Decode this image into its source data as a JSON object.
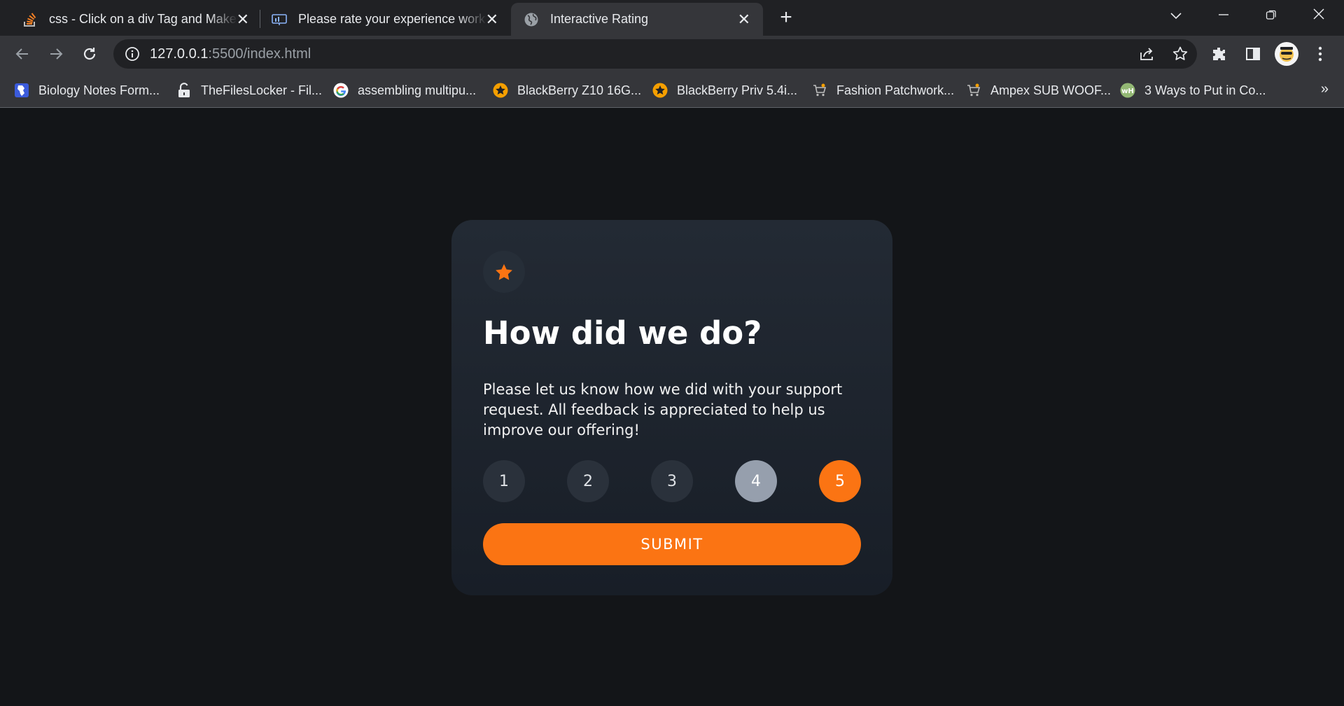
{
  "browser": {
    "tabs": [
      {
        "title": "css - Click on a div Tag and Make",
        "icon": "stackoverflow-icon"
      },
      {
        "title": "Please rate your experience work",
        "icon": "presentation-icon"
      },
      {
        "title": "Interactive Rating",
        "icon": "globe-icon"
      }
    ],
    "new_tab": "+",
    "url_host": "127.0.0.1",
    "url_rest": ":5500/index.html",
    "bookmarks": [
      {
        "label": "Biology Notes Form...",
        "icon": "africa-map-icon"
      },
      {
        "label": "TheFilesLocker - Fil...",
        "icon": "padlock-icon"
      },
      {
        "label": "assembling multipu...",
        "icon": "google-icon"
      },
      {
        "label": "BlackBerry Z10 16G...",
        "icon": "orange-star-icon"
      },
      {
        "label": "BlackBerry Priv 5.4i...",
        "icon": "orange-star-icon"
      },
      {
        "label": "Fashion Patchwork...",
        "icon": "cart-icon"
      },
      {
        "label": "Ampex SUB WOOF...",
        "icon": "cart-icon"
      },
      {
        "label": "3 Ways to Put in Co...",
        "icon": "wikihow-icon"
      }
    ],
    "bookmarks_more": "»"
  },
  "colors": {
    "accent": "#fb7413",
    "hover_gray": "#969fad",
    "page_bg": "#131518",
    "card_top": "#232a34",
    "card_bottom": "#181e27"
  },
  "card": {
    "icon": "star-icon",
    "title": "How did we do?",
    "description": "Please let us know how we did with your support request. All feedback is appreciated to help us improve our offering!",
    "ratings": [
      "1",
      "2",
      "3",
      "4",
      "5"
    ],
    "hovered_rating": "4",
    "selected_rating": "5",
    "submit_label": "SUBMIT"
  }
}
